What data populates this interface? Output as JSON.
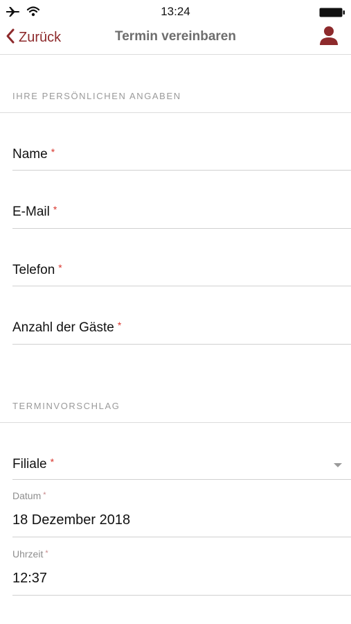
{
  "status_bar": {
    "time": "13:24",
    "icons": [
      "airplane-icon",
      "wifi-icon",
      "battery-icon"
    ]
  },
  "nav": {
    "back_label": "Zurück",
    "title": "Termin vereinbaren",
    "accent_color": "#8d2a2c"
  },
  "personal_section": {
    "header": "IHRE PERSÖNLICHEN ANGABEN",
    "fields": [
      {
        "label": "Name",
        "required": "*"
      },
      {
        "label": "E-Mail",
        "required": "*"
      },
      {
        "label": "Telefon",
        "required": "*"
      },
      {
        "label": "Anzahl der Gäste",
        "required": "*"
      }
    ]
  },
  "appointment_section": {
    "header": "TERMINVORSCHLAG",
    "branch": {
      "label": "Filiale",
      "required": "*"
    },
    "date": {
      "label": "Datum",
      "required": "*",
      "value": "18 Dezember 2018"
    },
    "time": {
      "label": "Uhrzeit",
      "required": "*",
      "value": "12:37"
    }
  },
  "colors": {
    "required_marker": "#d9342b",
    "section_header": "#9a9a9a"
  }
}
